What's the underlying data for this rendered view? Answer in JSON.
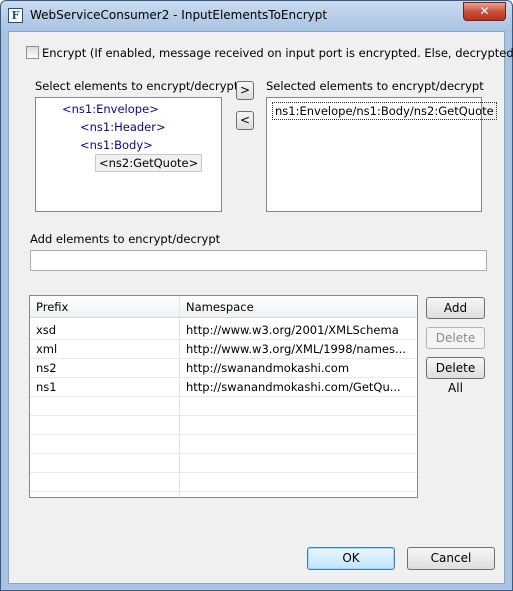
{
  "window": {
    "title": "WebServiceConsumer2 - InputElementsToEncrypt",
    "close_label": "✕"
  },
  "encrypt": {
    "label": "Encrypt (If enabled, message received on input port is encrypted. Else, decrypted.)",
    "checked": false
  },
  "source": {
    "label": "Select elements to encrypt/decrypt",
    "items": [
      "<ns1:Envelope>",
      "<ns1:Header>",
      "<ns1:Body>",
      "<ns2:GetQuote>"
    ]
  },
  "move": {
    "add_label": ">",
    "remove_label": "<"
  },
  "selected": {
    "label": "Selected elements to encrypt/decrypt",
    "items": [
      "ns1:Envelope/ns1:Body/ns2:GetQuote"
    ]
  },
  "add_elements": {
    "label": "Add elements to encrypt/decrypt",
    "value": ""
  },
  "namespaces": {
    "columns": [
      "Prefix",
      "Namespace"
    ],
    "rows": [
      {
        "prefix": "xsd",
        "namespace": "http://www.w3.org/2001/XMLSchema"
      },
      {
        "prefix": "xml",
        "namespace": "http://www.w3.org/XML/1998/names..."
      },
      {
        "prefix": "ns2",
        "namespace": "http://swanandmokashi.com"
      },
      {
        "prefix": "ns1",
        "namespace": "http://swanandmokashi.com/GetQu..."
      }
    ]
  },
  "table_buttons": {
    "add": "Add",
    "delete": "Delete",
    "delete_all": "Delete All"
  },
  "footer": {
    "ok": "OK",
    "cancel": "Cancel"
  }
}
